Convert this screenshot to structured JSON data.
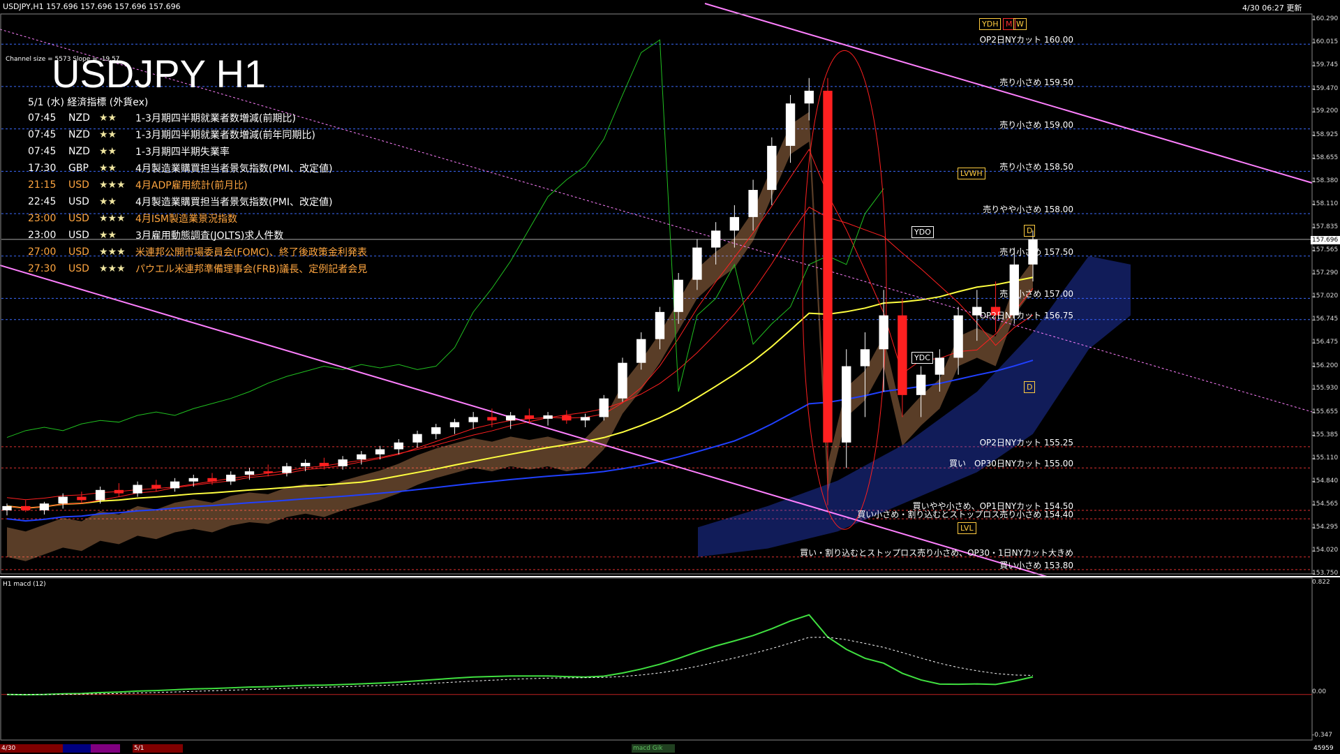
{
  "header": {
    "symbol_line": "USDJPY,H1   157.696  157.696  157.696  157.696",
    "timestamp": "4/30  06:27  更新",
    "channel_info": "Channel size = 5573 Slope = -19.57",
    "title": "USDJPY H1"
  },
  "calendar": {
    "heading": "5/1 (水) 経済指標 (外貨ex)",
    "rows": [
      {
        "time": "07:45",
        "cur": "NZD",
        "stars": "★★",
        "text": "1-3月期四半期就業者数増減(前期比)",
        "color": "#ffffff"
      },
      {
        "time": "07:45",
        "cur": "NZD",
        "stars": "★★",
        "text": "1-3月期四半期就業者数増減(前年同期比)",
        "color": "#ffffff"
      },
      {
        "time": "07:45",
        "cur": "NZD",
        "stars": "★★",
        "text": "1-3月期四半期失業率",
        "color": "#ffffff"
      },
      {
        "time": "17:30",
        "cur": "GBP",
        "stars": "★★",
        "text": "4月製造業購買担当者景気指数(PMI、改定値)",
        "color": "#ffffff"
      },
      {
        "time": "21:15",
        "cur": "USD",
        "stars": "★★★",
        "text": "4月ADP雇用統計(前月比)",
        "color": "#ffa640"
      },
      {
        "time": "22:45",
        "cur": "USD",
        "stars": "★★",
        "text": "4月製造業購買担当者景気指数(PMI、改定値)",
        "color": "#ffffff"
      },
      {
        "time": "23:00",
        "cur": "USD",
        "stars": "★★★",
        "text": "4月ISM製造業景況指数",
        "color": "#ffa640"
      },
      {
        "time": "23:00",
        "cur": "USD",
        "stars": "★★",
        "text": "3月雇用動態調査(JOLTS)求人件数",
        "color": "#ffffff"
      },
      {
        "time": "27:00",
        "cur": "USD",
        "stars": "★★★",
        "text": "米連邦公開市場委員会(FOMC)、終了後政策金利発表",
        "color": "#ffa640"
      },
      {
        "time": "27:30",
        "cur": "USD",
        "stars": "★★★",
        "text": "パウエル米連邦準備理事会(FRB)議長、定例記者会見",
        "color": "#ffa640"
      }
    ]
  },
  "levels": [
    {
      "price": 160.0,
      "label": "OP2日NYカット 160.00",
      "color": "#3c6cff"
    },
    {
      "price": 159.5,
      "label": "売り小さめ 159.50",
      "color": "#3c6cff"
    },
    {
      "price": 159.0,
      "label": "売り小さめ 159.00",
      "color": "#3c6cff"
    },
    {
      "price": 158.5,
      "label": "売り小さめ 158.50",
      "color": "#3c6cff"
    },
    {
      "price": 158.0,
      "label": "売りやや小さめ 158.00",
      "color": "#3c6cff"
    },
    {
      "price": 157.5,
      "label": "売り小さめ 157.50",
      "color": "#3c6cff"
    },
    {
      "price": 157.0,
      "label": "売り小さめ 157.00",
      "color": "#3c6cff"
    },
    {
      "price": 156.75,
      "label": "OP2日NYカット 156.75",
      "color": "#3c6cff"
    },
    {
      "price": 155.25,
      "label": "OP2日NYカット 155.25",
      "color": "#e03030"
    },
    {
      "price": 155.0,
      "label": "買い　OP30日NYカット 155.00",
      "color": "#e03030"
    },
    {
      "price": 154.5,
      "label": "買いやや小さめ、OP1日NYカット 154.50",
      "color": "#e03030"
    },
    {
      "price": 154.4,
      "label": "買い小さめ・割り込むとストップロス売り小さめ 154.40",
      "color": "#e03030"
    },
    {
      "price": 153.95,
      "label": "買い・割り込むとストップロス売り小さめ、OP30・1日NYカット大きめ",
      "color": "#e03030"
    },
    {
      "price": 153.8,
      "label": "買い小さめ 153.80",
      "color": "#e03030"
    }
  ],
  "tags": {
    "ydh": "YDH",
    "m": "M",
    "w": "W",
    "lvwh": "LVWH",
    "ydo": "YDO",
    "ydc": "YDC",
    "d1": "D",
    "d2": "D",
    "lvl": "LVL"
  },
  "price_box": "157.696",
  "macd_label": "H1  macd (12)",
  "macd_axis": {
    "top": "0.822",
    "zero": "0.00",
    "bottom": "-0.347"
  },
  "bottom_bar": {
    "d1": "4/30",
    "d2": "5/1",
    "tab": "macd Gik",
    "right": "45959"
  },
  "colors": {
    "background": "#000000",
    "bull": "#ffffff",
    "bear": "#ff2020",
    "ma_yellow": "#ffff40",
    "ma_blue": "#2040ff",
    "ma_red": "#ff2020",
    "chikou": "#20c020",
    "trend": "#ff80ff",
    "cloud_orange": "#ffb070",
    "cloud_blue": "#3050ff",
    "macd_line": "#40e040",
    "macd_signal": "#ffffff"
  },
  "chart_data": {
    "type": "candlestick",
    "symbol": "USDJPY",
    "timeframe": "H1",
    "ylim": [
      153.75,
      160.29
    ],
    "price_ticks": [
      160.29,
      160.015,
      159.745,
      159.47,
      159.2,
      158.925,
      158.655,
      158.38,
      158.11,
      157.835,
      157.565,
      157.29,
      157.02,
      156.745,
      156.475,
      156.2,
      155.93,
      155.655,
      155.385,
      155.11,
      154.84,
      154.565,
      154.295,
      154.02,
      153.75
    ],
    "current_price": 157.696,
    "bars": [
      [
        154.5,
        154.58,
        154.44,
        154.55
      ],
      [
        154.55,
        154.62,
        154.48,
        154.5
      ],
      [
        154.5,
        154.6,
        154.45,
        154.58
      ],
      [
        154.58,
        154.7,
        154.52,
        154.66
      ],
      [
        154.66,
        154.72,
        154.58,
        154.62
      ],
      [
        154.62,
        154.78,
        154.58,
        154.74
      ],
      [
        154.74,
        154.82,
        154.66,
        154.7
      ],
      [
        154.7,
        154.84,
        154.66,
        154.8
      ],
      [
        154.8,
        154.86,
        154.72,
        154.76
      ],
      [
        154.76,
        154.88,
        154.72,
        154.84
      ],
      [
        154.84,
        154.92,
        154.78,
        154.88
      ],
      [
        154.88,
        154.94,
        154.8,
        154.84
      ],
      [
        154.84,
        154.96,
        154.8,
        154.92
      ],
      [
        154.92,
        155.0,
        154.86,
        154.96
      ],
      [
        154.96,
        155.04,
        154.9,
        154.94
      ],
      [
        154.94,
        155.06,
        154.9,
        155.02
      ],
      [
        155.02,
        155.1,
        154.96,
        155.06
      ],
      [
        155.06,
        155.12,
        154.98,
        155.02
      ],
      [
        155.02,
        155.14,
        154.98,
        155.1
      ],
      [
        155.1,
        155.2,
        155.04,
        155.16
      ],
      [
        155.16,
        155.26,
        155.1,
        155.22
      ],
      [
        155.22,
        155.34,
        155.16,
        155.3
      ],
      [
        155.3,
        155.44,
        155.24,
        155.4
      ],
      [
        155.4,
        155.52,
        155.34,
        155.48
      ],
      [
        155.48,
        155.58,
        155.4,
        155.54
      ],
      [
        155.54,
        155.66,
        155.46,
        155.6
      ],
      [
        155.6,
        155.7,
        155.48,
        155.56
      ],
      [
        155.56,
        155.66,
        155.46,
        155.62
      ],
      [
        155.62,
        155.7,
        155.52,
        155.58
      ],
      [
        155.58,
        155.66,
        155.5,
        155.62
      ],
      [
        155.62,
        155.68,
        155.52,
        155.56
      ],
      [
        155.56,
        155.64,
        155.48,
        155.6
      ],
      [
        155.6,
        155.86,
        155.56,
        155.82
      ],
      [
        155.82,
        156.3,
        155.78,
        156.24
      ],
      [
        156.24,
        156.6,
        156.16,
        156.52
      ],
      [
        156.52,
        156.9,
        156.4,
        156.84
      ],
      [
        156.84,
        157.3,
        156.7,
        157.22
      ],
      [
        157.22,
        157.7,
        157.1,
        157.6
      ],
      [
        157.6,
        157.9,
        157.4,
        157.8
      ],
      [
        157.8,
        158.1,
        157.6,
        157.96
      ],
      [
        157.96,
        158.4,
        157.8,
        158.28
      ],
      [
        158.28,
        158.9,
        158.1,
        158.8
      ],
      [
        158.8,
        159.4,
        158.6,
        159.3
      ],
      [
        159.3,
        159.6,
        159.1,
        159.45
      ],
      [
        159.45,
        159.6,
        154.56,
        155.3
      ],
      [
        155.3,
        156.4,
        155.0,
        156.2
      ],
      [
        156.2,
        156.6,
        155.6,
        156.4
      ],
      [
        156.4,
        157.1,
        155.9,
        156.8
      ],
      [
        156.8,
        157.0,
        155.6,
        155.86
      ],
      [
        155.86,
        156.2,
        155.6,
        156.1
      ],
      [
        156.1,
        156.4,
        155.9,
        156.3
      ],
      [
        156.3,
        156.9,
        156.1,
        156.8
      ],
      [
        156.8,
        157.1,
        156.5,
        156.9
      ],
      [
        156.9,
        157.2,
        156.6,
        156.8
      ],
      [
        156.8,
        157.6,
        156.7,
        157.4
      ],
      [
        157.4,
        157.8,
        157.2,
        157.696
      ]
    ],
    "macd_range": [
      -0.347,
      0.822
    ]
  }
}
